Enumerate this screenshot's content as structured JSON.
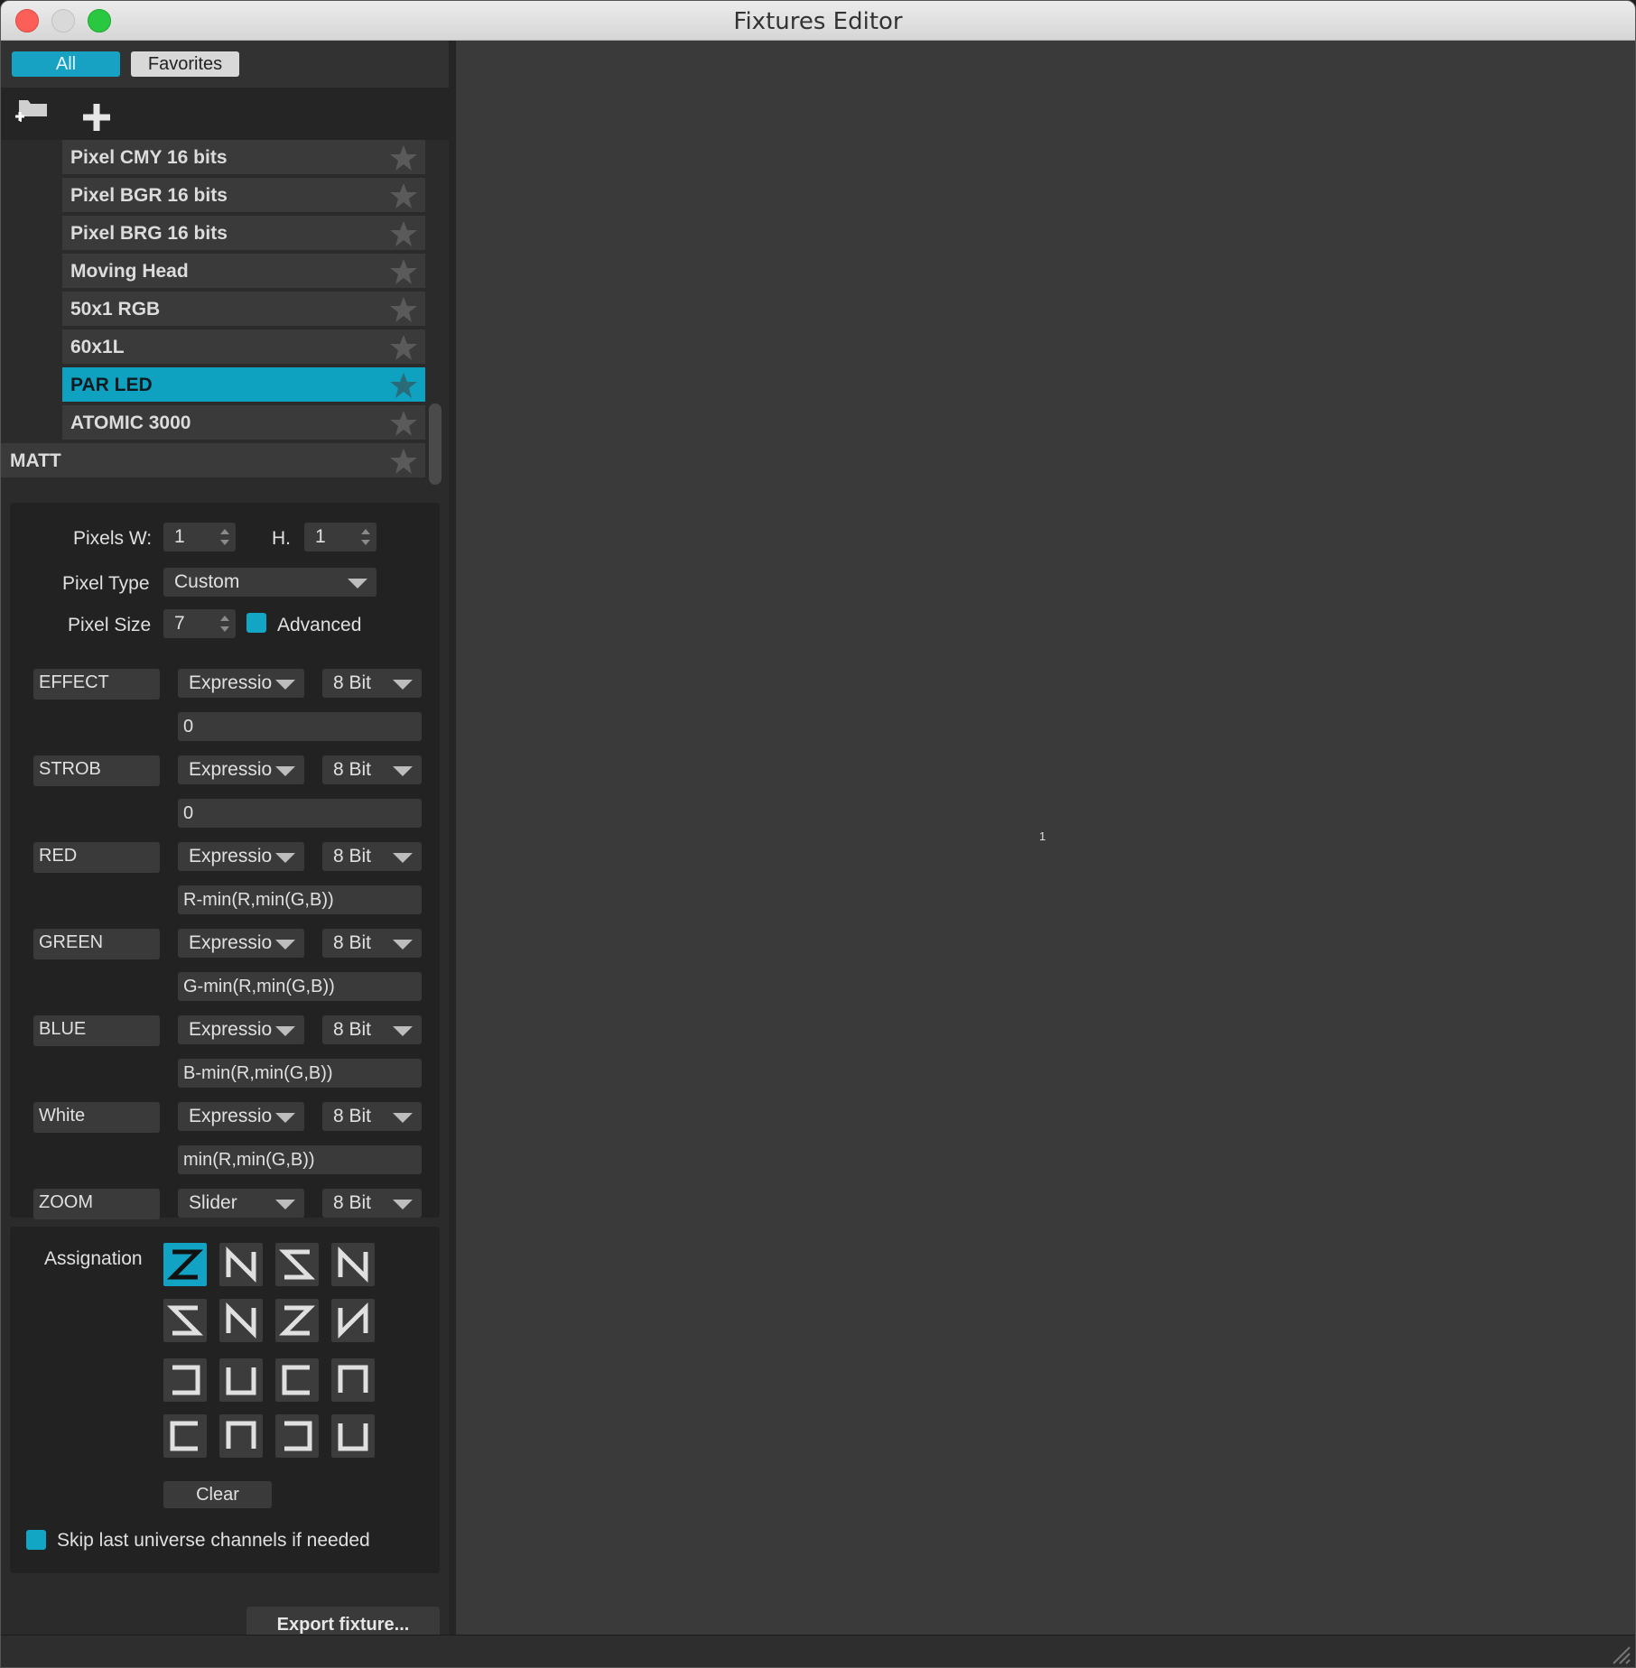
{
  "window": {
    "title": "Fixtures Editor"
  },
  "tabs": {
    "all": "All",
    "favorites": "Favorites"
  },
  "fixtures": [
    {
      "name": "Pixel CMY 16 bits",
      "favorite": false
    },
    {
      "name": "Pixel BGR 16 bits",
      "favorite": false
    },
    {
      "name": "Pixel BRG 16 bits",
      "favorite": false
    },
    {
      "name": "Moving Head",
      "favorite": false
    },
    {
      "name": "50x1 RGB",
      "favorite": false
    },
    {
      "name": "60x1L",
      "favorite": false
    },
    {
      "name": "PAR LED",
      "favorite": false,
      "selected": true
    },
    {
      "name": "ATOMIC 3000",
      "favorite": false
    }
  ],
  "group": {
    "name": "MATT"
  },
  "props": {
    "pixels_w_label": "Pixels W:",
    "pixels_w": "1",
    "h_label": "H.",
    "h": "1",
    "pixel_type_label": "Pixel Type",
    "pixel_type": "Custom",
    "pixel_size_label": "Pixel Size",
    "pixel_size": "7",
    "advanced_label": "Advanced",
    "advanced_checked": true
  },
  "channels": [
    {
      "name": "EFFECT",
      "mode": "Expressio",
      "bits": "8 Bit",
      "expr": "0"
    },
    {
      "name": "STROB",
      "mode": "Expressio",
      "bits": "8 Bit",
      "expr": "0"
    },
    {
      "name": "RED",
      "mode": "Expressio",
      "bits": "8 Bit",
      "expr": "R-min(R,min(G,B))"
    },
    {
      "name": "GREEN",
      "mode": "Expressio",
      "bits": "8 Bit",
      "expr": "G-min(R,min(G,B))"
    },
    {
      "name": "BLUE",
      "mode": "Expressio",
      "bits": "8 Bit",
      "expr": "B-min(R,min(G,B))"
    },
    {
      "name": "White",
      "mode": "Expressio",
      "bits": "8 Bit",
      "expr": "min(R,min(G,B))"
    },
    {
      "name": "ZOOM",
      "mode": "Slider",
      "bits": "8 Bit"
    }
  ],
  "assignation": {
    "label": "Assignation",
    "clear": "Clear",
    "skip_label": "Skip last universe channels if needed",
    "skip_checked": true,
    "patterns": [
      "zigzag-z-icon",
      "zigzag-n-icon",
      "zigzag-z-rev-icon",
      "zigzag-n-rev-icon",
      "zigzag-s-icon",
      "zigzag-n-up-icon",
      "zigzag-s-rev-icon",
      "zigzag-n-down-icon",
      "snake-left-icon",
      "snake-up-icon",
      "snake-right-icon",
      "snake-down-icon",
      "snake-left-rev-icon",
      "snake-up-rev-icon",
      "snake-right-rev-icon",
      "snake-down-rev-icon"
    ]
  },
  "export": "Export fixture...",
  "preview": {
    "pixel_index": "1"
  },
  "colors": {
    "accent": "#12a2c3",
    "panel": "#2b2b2b",
    "viewport": "#3a3a3a"
  }
}
